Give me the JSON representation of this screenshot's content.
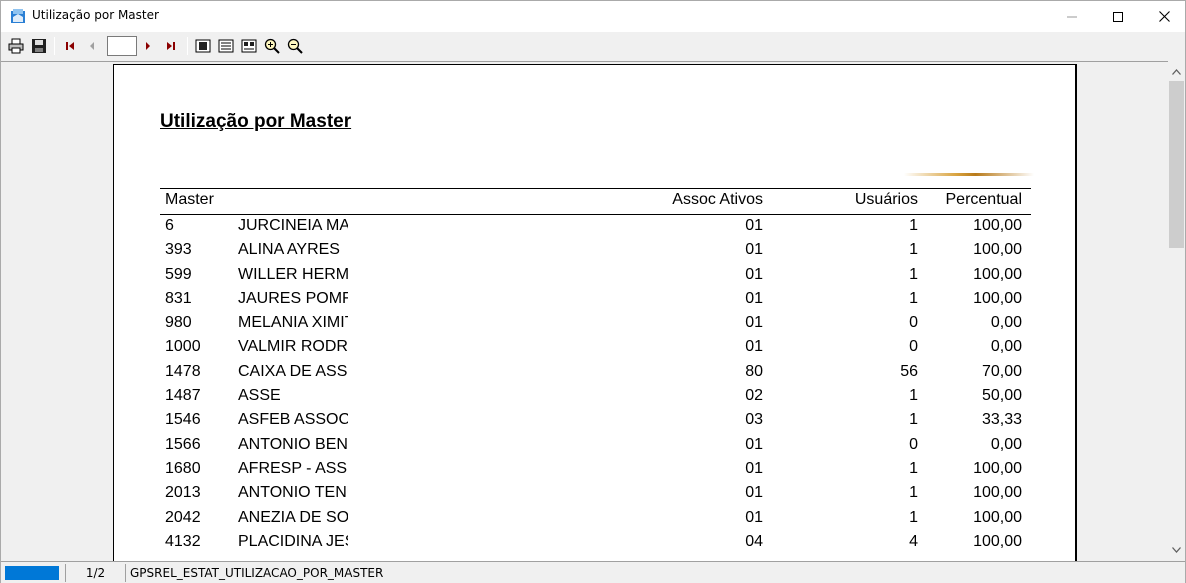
{
  "window": {
    "title": "Utilização por Master",
    "minimize_icon": "minimize-icon",
    "maximize_icon": "maximize-icon",
    "close_icon": "close-icon"
  },
  "toolbar": {
    "buttons": [
      "print-icon",
      "save-icon",
      "first-page-icon",
      "previous-page-icon",
      "next-page-icon",
      "last-page-icon",
      "page-width-icon",
      "whole-page-icon",
      "multiple-pages-icon",
      "zoom-in-icon",
      "zoom-out-icon"
    ],
    "page_value": ""
  },
  "report": {
    "title": "Utilização por Master",
    "columns": {
      "master": "Master",
      "assoc": "Assoc Ativos",
      "users": "Usuários",
      "percent": "Percentual"
    },
    "rows": [
      {
        "master": "6",
        "name": "JURCINEIA MA",
        "assoc": "01",
        "users": "1",
        "percent": "100,00"
      },
      {
        "master": "393",
        "name": "ALINA AYRES",
        "assoc": "01",
        "users": "1",
        "percent": "100,00"
      },
      {
        "master": "599",
        "name": "WILLER HERM",
        "assoc": "01",
        "users": "1",
        "percent": "100,00"
      },
      {
        "master": "831",
        "name": "JAURES POMF",
        "assoc": "01",
        "users": "1",
        "percent": "100,00"
      },
      {
        "master": "980",
        "name": "MELANIA XIMIT",
        "assoc": "01",
        "users": "0",
        "percent": "0,00"
      },
      {
        "master": "1000",
        "name": "VALMIR RODR",
        "assoc": "01",
        "users": "0",
        "percent": "0,00"
      },
      {
        "master": "1478",
        "name": "CAIXA DE ASS",
        "assoc": "80",
        "users": "56",
        "percent": "70,00"
      },
      {
        "master": "1487",
        "name": "ASSE",
        "assoc": "02",
        "users": "1",
        "percent": "50,00"
      },
      {
        "master": "1546",
        "name": "ASFEB ASSOC",
        "assoc": "03",
        "users": "1",
        "percent": "33,33"
      },
      {
        "master": "1566",
        "name": "ANTONIO BENI",
        "assoc": "01",
        "users": "0",
        "percent": "0,00"
      },
      {
        "master": "1680",
        "name": "AFRESP  - ASS",
        "assoc": "01",
        "users": "1",
        "percent": "100,00"
      },
      {
        "master": "2013",
        "name": "ANTONIO TENU",
        "assoc": "01",
        "users": "1",
        "percent": "100,00"
      },
      {
        "master": "2042",
        "name": "ANEZIA DE SO",
        "assoc": "01",
        "users": "1",
        "percent": "100,00"
      },
      {
        "master": "4132",
        "name": "PLACIDINA JES",
        "assoc": "04",
        "users": "4",
        "percent": "100,00"
      }
    ]
  },
  "status": {
    "page": "1/2",
    "report_name": "GPSREL_ESTAT_UTILIZACAO_POR_MASTER"
  },
  "colors": {
    "progress": "#0078d7",
    "background": "#f0f0f0"
  }
}
